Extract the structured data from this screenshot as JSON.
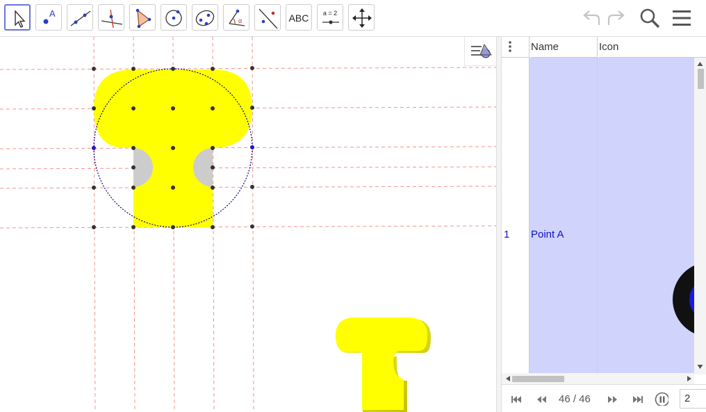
{
  "toolbar": {
    "tools": [
      {
        "name": "move-tool",
        "icon": "arrow-cursor-icon",
        "selected": true
      },
      {
        "name": "point-tool",
        "icon": "point-icon",
        "label": "A"
      },
      {
        "name": "line-tool",
        "icon": "line-icon"
      },
      {
        "name": "perpendicular-line-tool",
        "icon": "perpendicular-line-icon"
      },
      {
        "name": "polygon-tool",
        "icon": "polygon-icon"
      },
      {
        "name": "circle-center-point-tool",
        "icon": "circle-center-icon"
      },
      {
        "name": "ellipse-tool",
        "icon": "ellipse-icon"
      },
      {
        "name": "angle-tool",
        "icon": "angle-icon"
      },
      {
        "name": "reflect-tool",
        "icon": "reflect-icon"
      },
      {
        "name": "text-tool",
        "icon": "text-icon",
        "label": "ABC"
      },
      {
        "name": "slider-tool",
        "icon": "slider-icon",
        "label": "a = 2"
      },
      {
        "name": "move-graphics-view-tool",
        "icon": "move-view-icon"
      }
    ],
    "undo_icon": "undo-icon",
    "redo_icon": "redo-icon",
    "search_icon": "search-icon",
    "menu_icon": "hamburger-menu-icon"
  },
  "graphics": {
    "stylebar_icon": "graphics-stylebar-icon",
    "colors": {
      "grid": "#f08080",
      "shape_fill": "#ffff00",
      "hole_fill": "#cccccc",
      "circle": "#000080",
      "point_dark": "#333333",
      "point_blue": "#1a1acc"
    }
  },
  "construction": {
    "menu_icon": "vertical-dots-icon",
    "columns": [
      "Name",
      "Icon"
    ],
    "rows": [
      {
        "number": "1",
        "name": "Point A"
      }
    ],
    "highlight_color": "#d0d4fc"
  },
  "playbar": {
    "first_icon": "skip-first-icon",
    "prev_icon": "step-back-icon",
    "step_text": "46 / 46",
    "next_icon": "step-forward-icon",
    "last_icon": "skip-last-icon",
    "pause_icon": "pause-icon",
    "speed_value": "2"
  }
}
